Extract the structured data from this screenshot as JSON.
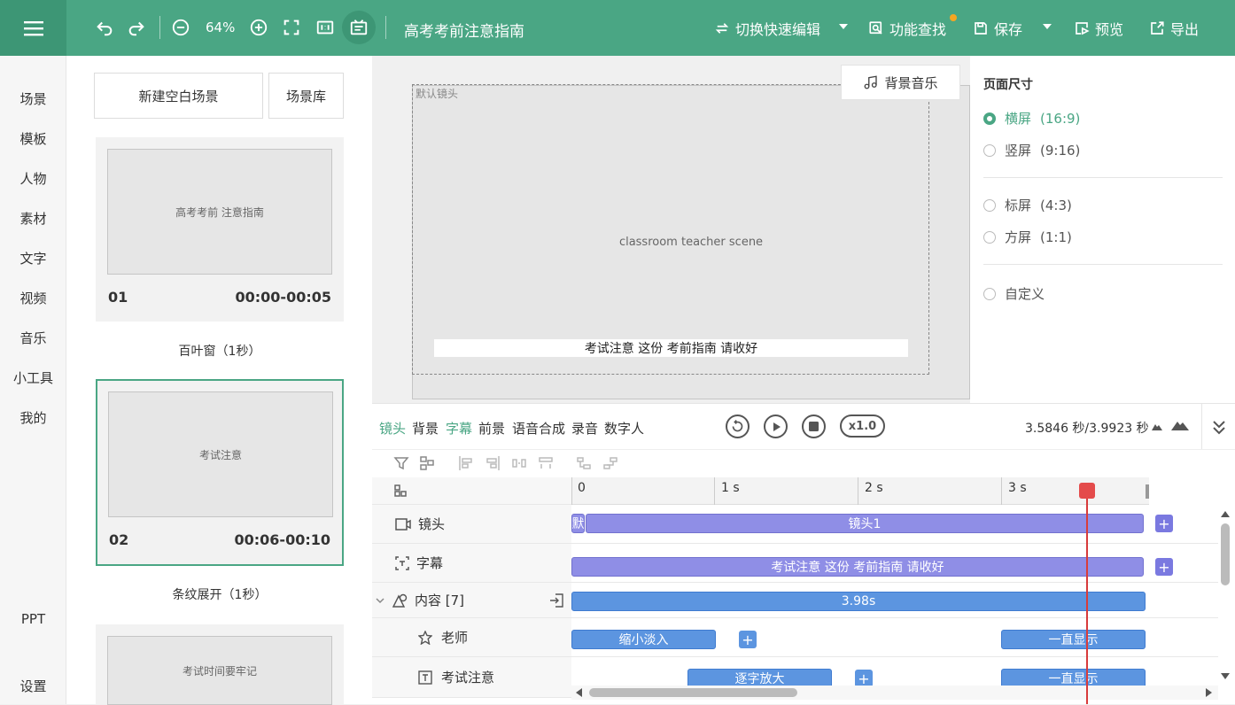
{
  "topbar": {
    "zoom": "64%",
    "doc_title": "高考考前注意指南",
    "switch_edit": "切换快速编辑",
    "feature_search": "功能查找",
    "save": "保存",
    "preview": "预览",
    "export": "导出"
  },
  "leftnav": [
    "场景",
    "模板",
    "人物",
    "素材",
    "文字",
    "视频",
    "音乐",
    "小工具",
    "我的",
    "PPT",
    "设置"
  ],
  "scenes": {
    "new_blank": "新建空白场景",
    "library": "场景库",
    "items": [
      {
        "num": "01",
        "time": "00:00-00:05",
        "transition": "百叶窗（1秒）",
        "thumb_label": "高考考前 注意指南"
      },
      {
        "num": "02",
        "time": "00:06-00:10",
        "transition": "条纹展开（1秒）",
        "thumb_label": "考试注意"
      },
      {
        "thumb_label": "考试时间要牢记"
      }
    ]
  },
  "canvas": {
    "bg_music": "背景音乐",
    "frame_label": "默认镜头",
    "subtitle": "考试注意 这份 考前指南 请收好",
    "scene_image": "classroom teacher scene"
  },
  "page_size": {
    "title": "页面尺寸",
    "options": [
      {
        "label": "横屏",
        "ratio": "(16:9)",
        "selected": true
      },
      {
        "label": "竖屏",
        "ratio": "(9:16)",
        "selected": false
      },
      {
        "label": "标屏",
        "ratio": "(4:3)",
        "selected": false
      },
      {
        "label": "方屏",
        "ratio": "(1:1)",
        "selected": false
      },
      {
        "label": "自定义",
        "ratio": "",
        "selected": false
      }
    ]
  },
  "timeline": {
    "tabs": [
      "镜头",
      "背景",
      "字幕",
      "前景",
      "语音合成",
      "录音",
      "数字人"
    ],
    "speed": "x1.0",
    "time": "3.5846 秒/3.9923 秒",
    "ruler": [
      "0",
      "1 s",
      "2 s",
      "3 s"
    ],
    "rows": {
      "camera": {
        "label": "镜头",
        "block_default": "默",
        "block": "镜头1"
      },
      "subtitle": {
        "label": "字幕",
        "block": "考试注意 这份 考前指南 请收好"
      },
      "content": {
        "label": "内容 [7]",
        "block": "3.98s"
      },
      "teacher": {
        "label": "老师",
        "block1": "缩小淡入",
        "block2": "一直显示"
      },
      "exam_note": {
        "label": "考试注意",
        "block1": "逐字放大",
        "block2": "一直显示"
      }
    }
  }
}
